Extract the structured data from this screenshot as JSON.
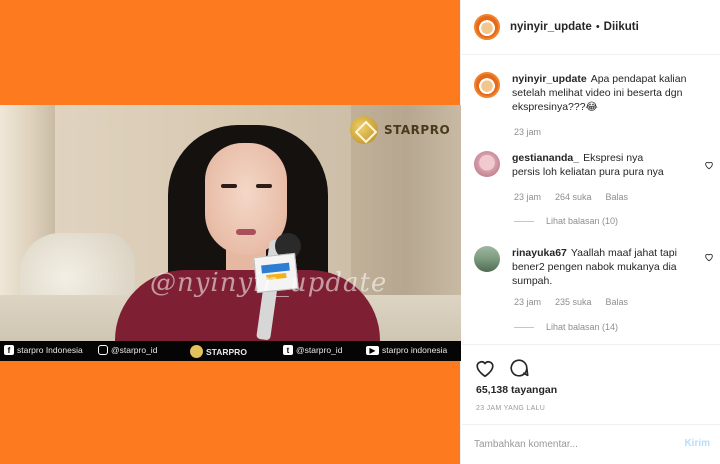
{
  "post": {
    "username": "nyinyir_update",
    "separator": "•",
    "follow_status": "Diikuti",
    "caption": {
      "user": "nyinyir_update",
      "text": "Apa pendapat kalian setelah melihat video ini beserta dgn ekspresinya???😂",
      "time": "23 jam"
    }
  },
  "video": {
    "logo_text": "STARPRO",
    "watermark": "@nyinyir_update",
    "bottom_bar": {
      "facebook": "starpro Indonesia",
      "instagram": "@starpro_id",
      "brand": "STARPRO",
      "twitter": "@starpro_id",
      "youtube": "starpro indonesia"
    }
  },
  "comments": [
    {
      "user": "gestiananda_",
      "text": "Ekspresi nya persis loh keliatan pura pura nya",
      "time": "23 jam",
      "likes": "264 suka",
      "reply": "Balas",
      "view_replies": "Lihat balasan (10)"
    },
    {
      "user": "rinayuka67",
      "text": "Yaallah maaf jahat tapi bener2 pengen nabok mukanya dia sumpah.",
      "time": "23 jam",
      "likes": "235 suka",
      "reply": "Balas",
      "view_replies": "Lihat balasan (14)"
    }
  ],
  "stats": {
    "views": "65,138 tayangan",
    "posted": "23 JAM YANG LALU"
  },
  "composer": {
    "placeholder": "Tambahkan komentar...",
    "post_label": "Kirim"
  },
  "colors": {
    "background_orange": "#fe7a1f",
    "shirt": "#7e1f33",
    "post_button_disabled": "#b2dffc"
  }
}
